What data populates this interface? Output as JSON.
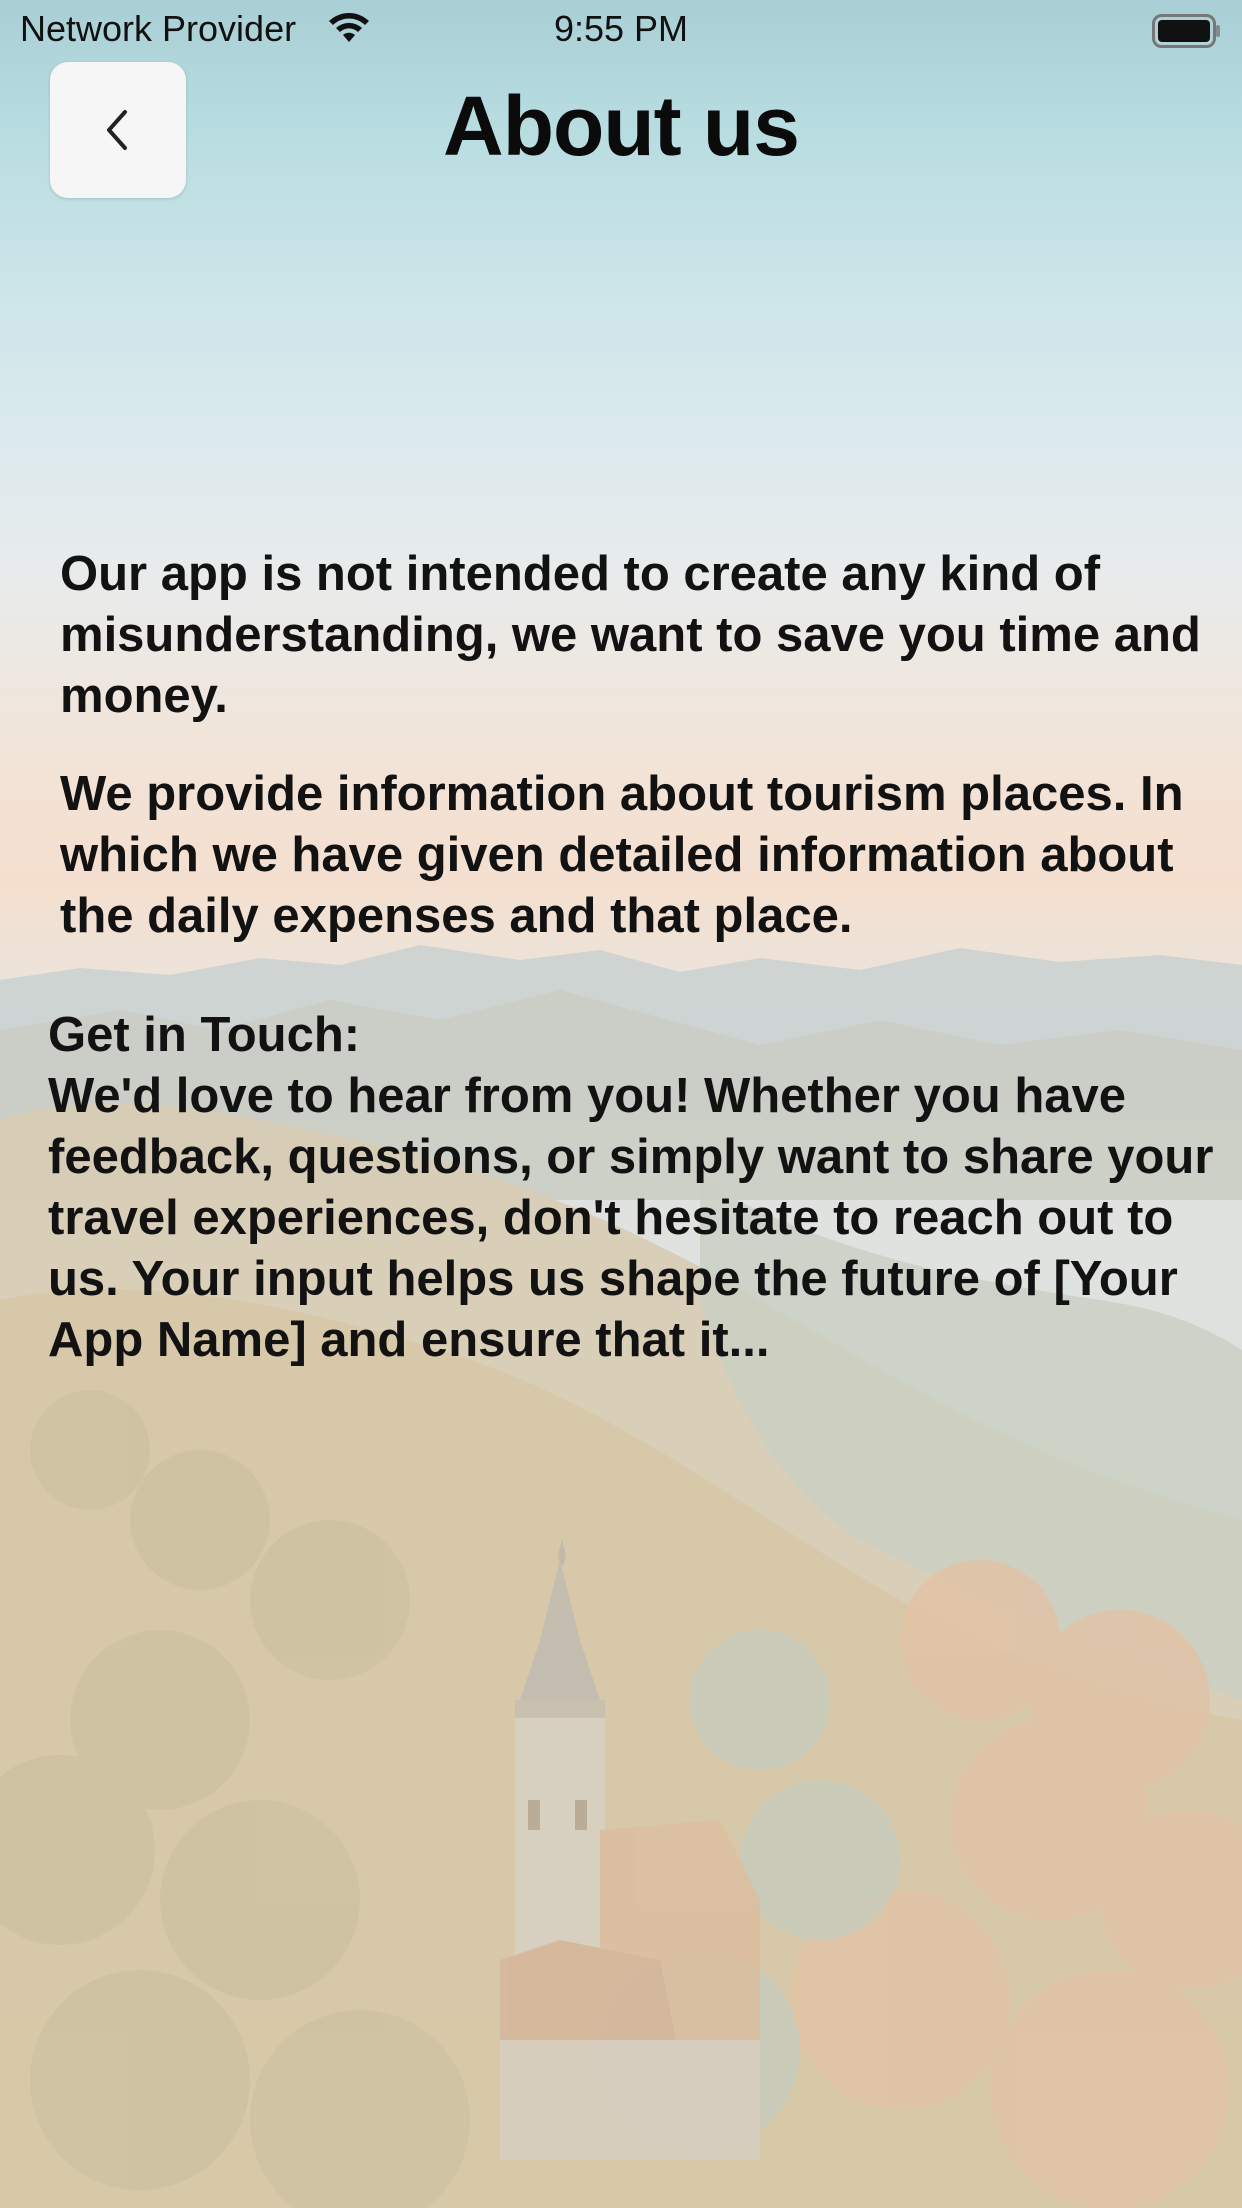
{
  "status_bar": {
    "carrier": "Network Provider",
    "time": "9:55 PM",
    "wifi_icon": "wifi-icon",
    "battery_icon": "battery-full-icon"
  },
  "header": {
    "back_icon": "chevron-left-icon",
    "title": "About us"
  },
  "content": {
    "paragraph_1": "Our app is not intended to create any kind of misunderstanding, we want to save you time and money.",
    "paragraph_2": "We provide information about tourism places. In which we have given detailed information about the daily expenses and that place.",
    "contact_heading": "Get in Touch:",
    "contact_body": "We'd love to hear from you! Whether you have feedback, questions, or simply want to share your travel experiences, don't hesitate to reach out to us. Your input helps us shape the future of [Your App Name] and ensure that it..."
  },
  "background": {
    "image": "faded-landscape-with-church-tower",
    "sky_color": "#b8dde1",
    "horizon_color": "#f4dfcf"
  }
}
